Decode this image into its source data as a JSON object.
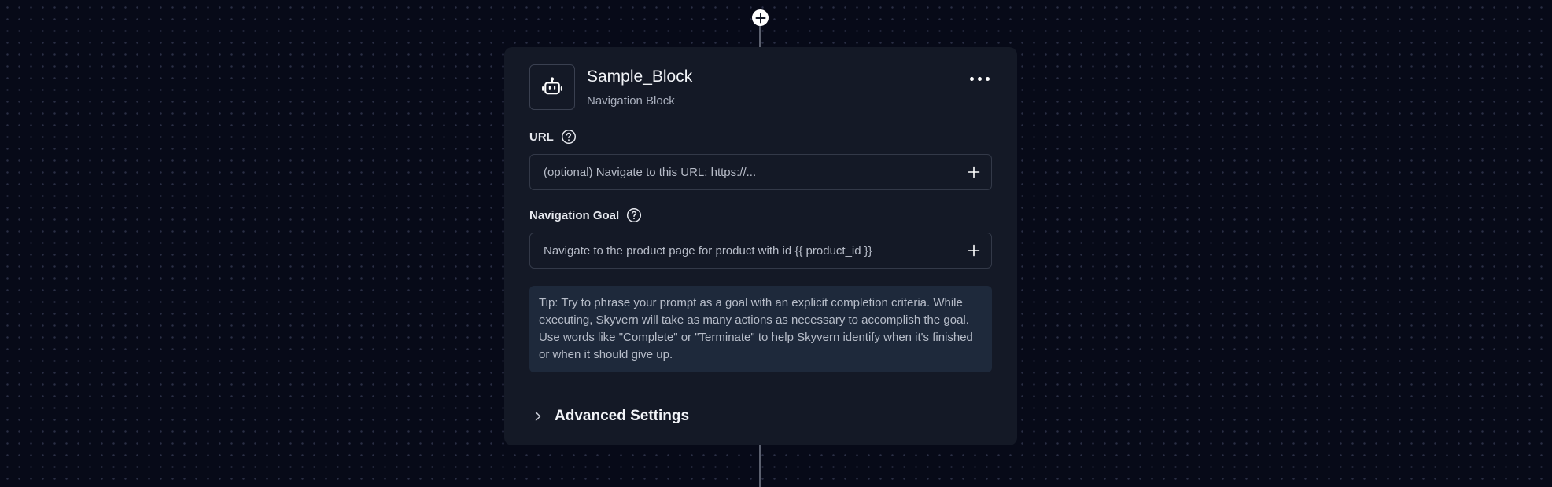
{
  "node": {
    "title": "Sample_Block",
    "subtitle": "Navigation Block",
    "icon": "robot-icon",
    "more_icon": "more-horizontal-icon"
  },
  "url_field": {
    "label": "URL",
    "placeholder": "(optional) Navigate to this URL: https://...",
    "value": ""
  },
  "goal_field": {
    "label": "Navigation Goal",
    "value": "Navigate to the product page for product with id {{ product_id }}"
  },
  "tip": {
    "text": "Tip: Try to phrase your prompt as a goal with an explicit completion criteria. While executing, Skyvern will take as many actions as necessary to accomplish the goal. Use words like \"Complete\" or \"Terminate\" to help Skyvern identify when it's finished or when it should give up."
  },
  "advanced": {
    "label": "Advanced Settings"
  },
  "colors": {
    "canvas_background": "#070a18",
    "card_background": "#141926",
    "tip_background": "#1e293b",
    "edge": "#5c6170"
  }
}
